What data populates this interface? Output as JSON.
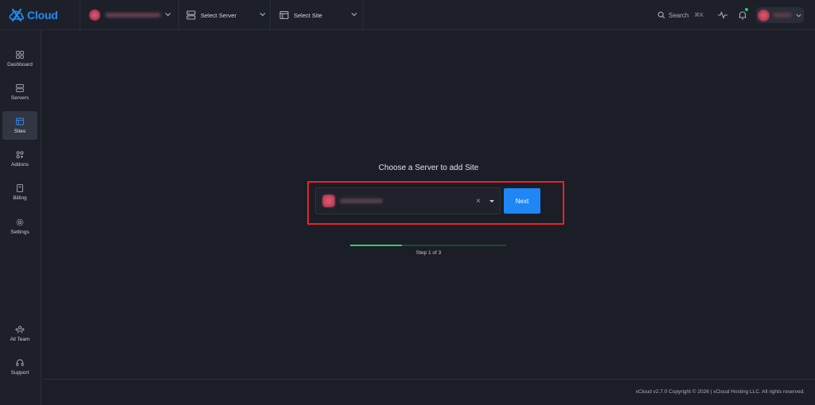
{
  "app": {
    "logo_text": "Cloud"
  },
  "topbar": {
    "team_selector": {
      "icon": "avatar",
      "value_obscured": true
    },
    "server_selector": {
      "label": "Select Server",
      "icon": "server-icon"
    },
    "site_selector": {
      "label": "Select Site",
      "icon": "browser-window-icon"
    },
    "search": {
      "label": "Search",
      "shortcut": "⌘K"
    },
    "activity_icon": "pulse-icon",
    "notification_icon": "bell-icon",
    "notification_dot_color": "#1fd160",
    "user_menu": {
      "name_obscured": true
    }
  },
  "sidebar": {
    "items": [
      {
        "label": "Dashboard",
        "icon": "grid-icon",
        "active": false
      },
      {
        "label": "Servers",
        "icon": "server-icon",
        "active": false
      },
      {
        "label": "Sites",
        "icon": "browser-window-icon",
        "active": true
      },
      {
        "label": "Addons",
        "icon": "addons-icon",
        "active": false
      },
      {
        "label": "Billing",
        "icon": "invoice-icon",
        "active": false
      },
      {
        "label": "Settings",
        "icon": "gear-icon",
        "active": false
      }
    ],
    "bottom_items": [
      {
        "label": "All Team",
        "icon": "team-icon"
      },
      {
        "label": "Support",
        "icon": "headset-icon"
      }
    ]
  },
  "main": {
    "title": "Choose a Server to add Site",
    "server_select": {
      "value_obscured": true,
      "clear_symbol": "×"
    },
    "next_button": "Next",
    "progress": {
      "current_step": 1,
      "total_steps": 3,
      "fraction": 0.333,
      "label": "Step 1 of 3"
    }
  },
  "footer": {
    "copyright": "xCloud v2.7.0 Copyright © 2026 | xCloud Hosting LLC. All rights reserved."
  },
  "colors": {
    "accent": "#1f86f6",
    "highlight_border": "#e8232a",
    "progress": "#2ecb6b",
    "background": "#1b1e26"
  }
}
